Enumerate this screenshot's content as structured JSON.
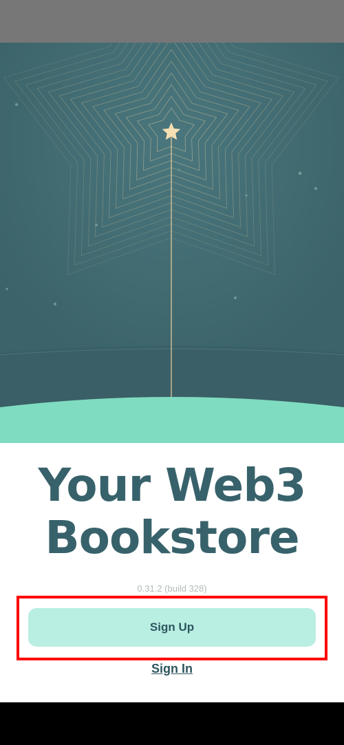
{
  "app": {
    "headline_line1": "Your Web3",
    "headline_line2": "Bookstore",
    "version": "0.31.2 (build 328)"
  },
  "actions": {
    "signup_label": "Sign Up",
    "signin_label": "Sign In"
  },
  "colors": {
    "hero_background": "#3e6870",
    "hill": "#7fdcc0",
    "headline": "#38626b",
    "signup_button_bg": "#b9eee2",
    "highlight": "#ff0000",
    "star": "#f6dfb3"
  },
  "icons": {
    "hero_star": "star-icon"
  }
}
